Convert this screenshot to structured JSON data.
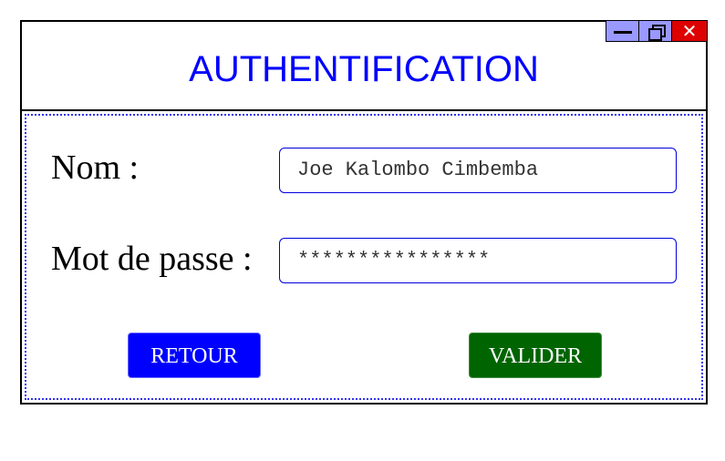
{
  "window": {
    "title": "AUTHENTIFICATION",
    "controls": {
      "minimize_icon": "minimize-icon",
      "maximize_icon": "restore-icon",
      "close_icon": "close-icon",
      "close_glyph": "✕"
    }
  },
  "form": {
    "name_label": "Nom :",
    "name_value": "Joe Kalombo Cimbemba",
    "password_label": "Mot de passe :",
    "password_value": "****************",
    "back_button": "RETOUR",
    "submit_button": "VALIDER"
  },
  "colors": {
    "title": "#0000ff",
    "field_border": "#0000dd",
    "back_button": "#0000ff",
    "submit_button": "#006400",
    "window_controls": "#9999ff",
    "close_button": "#dd0000"
  }
}
